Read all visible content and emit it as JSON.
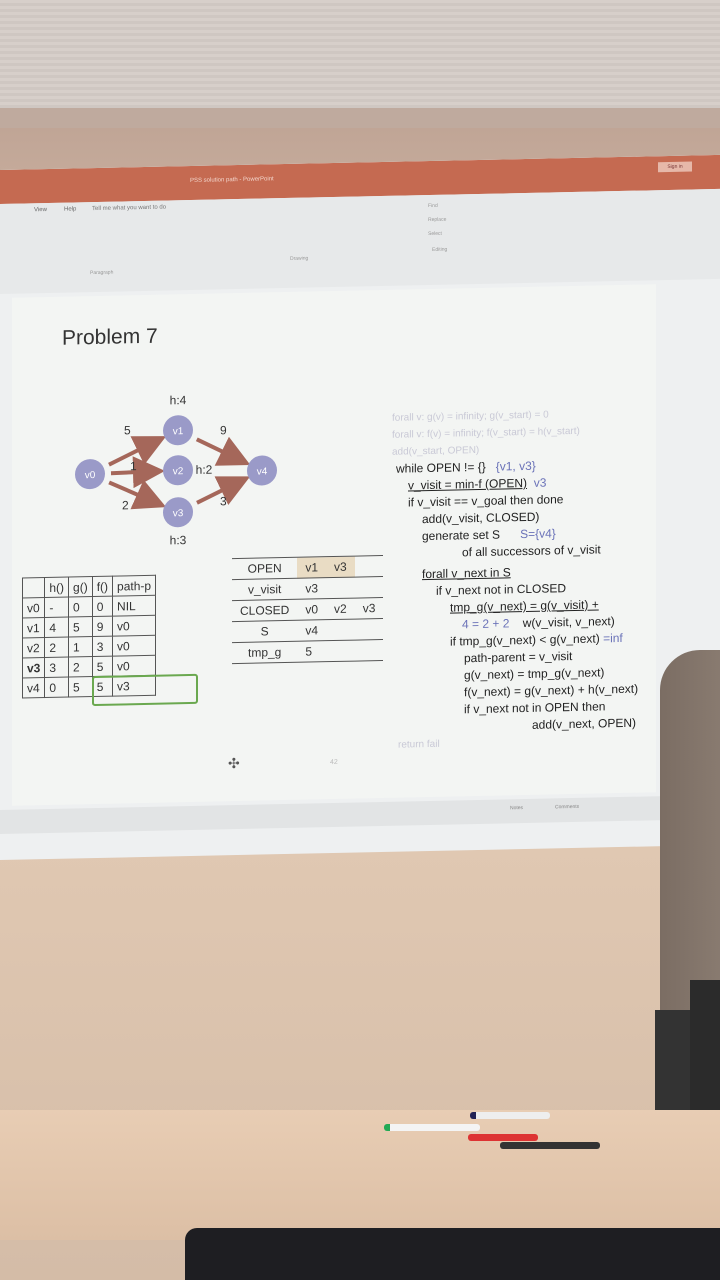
{
  "app": {
    "doc_title": "PSS solution path - PowerPoint",
    "sign_in": "Sign in"
  },
  "ribbon": {
    "tabs": [
      "View",
      "Help"
    ],
    "tell_me": "Tell me what you want to do",
    "groups": [
      "Paragraph",
      "Drawing",
      "Editing"
    ],
    "edit_items": [
      "Find",
      "Replace",
      "Select"
    ]
  },
  "slide": {
    "title": "Problem 7",
    "page_number": "42",
    "graph": {
      "nodes": [
        {
          "id": "v0",
          "label": "v0",
          "h": ""
        },
        {
          "id": "v1",
          "label": "v1",
          "h": "h:4"
        },
        {
          "id": "v2",
          "label": "v2",
          "h": "h:2"
        },
        {
          "id": "v3",
          "label": "v3",
          "h": "h:3"
        },
        {
          "id": "v4",
          "label": "v4",
          "h": ""
        }
      ],
      "edges": [
        {
          "from": "v0",
          "to": "v1",
          "w": "5"
        },
        {
          "from": "v0",
          "to": "v2",
          "w": "1"
        },
        {
          "from": "v0",
          "to": "v3",
          "w": "2"
        },
        {
          "from": "v1",
          "to": "v4",
          "w": "9"
        },
        {
          "from": "v3",
          "to": "v4",
          "w": "3"
        }
      ]
    },
    "table": {
      "headers": [
        "",
        "h()",
        "g()",
        "f()",
        "path-p"
      ],
      "rows": [
        [
          "v0",
          "-",
          "0",
          "0",
          "NIL"
        ],
        [
          "v1",
          "4",
          "5",
          "9",
          "v0"
        ],
        [
          "v2",
          "2",
          "1",
          "3",
          "v0"
        ],
        [
          "v3",
          "3",
          "2",
          "5",
          "v0"
        ],
        [
          "v4",
          "0",
          "5",
          "5",
          "v3"
        ]
      ]
    },
    "state": [
      {
        "label": "OPEN",
        "values": [
          "v1",
          "v3",
          ""
        ]
      },
      {
        "label": "v_visit",
        "values": [
          "v3",
          "",
          ""
        ]
      },
      {
        "label": "CLOSED",
        "values": [
          "v0",
          "v2",
          "v3"
        ]
      },
      {
        "label": "S",
        "values": [
          "v4",
          "",
          ""
        ]
      },
      {
        "label": "tmp_g",
        "values": [
          "5",
          "",
          ""
        ]
      }
    ],
    "algorithm": {
      "faded_top": [
        "forall v: g(v) = infinity; g(v_start) = 0",
        "forall v: f(v) = infinity; f(v_start) = h(v_start)",
        "add(v_start, OPEN)"
      ],
      "l1": "while OPEN != {}",
      "l1_ann": "{v1, v3}",
      "l2": "v_visit = min-f (OPEN)",
      "l2_ann": "v3",
      "l3": "if v_visit == v_goal then done",
      "l4": "add(v_visit, CLOSED)",
      "l5a": "generate set S",
      "l5_ann": "S={v4}",
      "l5b": "of all successors of v_visit",
      "l6": "forall v_next in S",
      "l7": "if v_next not in CLOSED",
      "l8": "tmp_g(v_next) = g(v_visit) +",
      "l8_ann": "4 = 2 + 2",
      "l8b": "w(v_visit, v_next)",
      "l9": "if tmp_g(v_next) < g(v_next)",
      "l9_ann": "=inf",
      "l10": "path-parent = v_visit",
      "l11": "g(v_next) = tmp_g(v_next)",
      "l12": "f(v_next) = g(v_next) + h(v_next)",
      "l13": "if v_next not in OPEN then",
      "l14": "add(v_next, OPEN)",
      "faded_bottom": "return fail"
    }
  },
  "statusbar": {
    "notes": "Notes",
    "comments": "Comments"
  },
  "colors": {
    "titlebar": "#c56a51",
    "node_fill": "#9a9ac8",
    "edge_arrow": "#a5675a",
    "annotation": "#6a72b8",
    "highlight_box": "#6aa84f"
  }
}
